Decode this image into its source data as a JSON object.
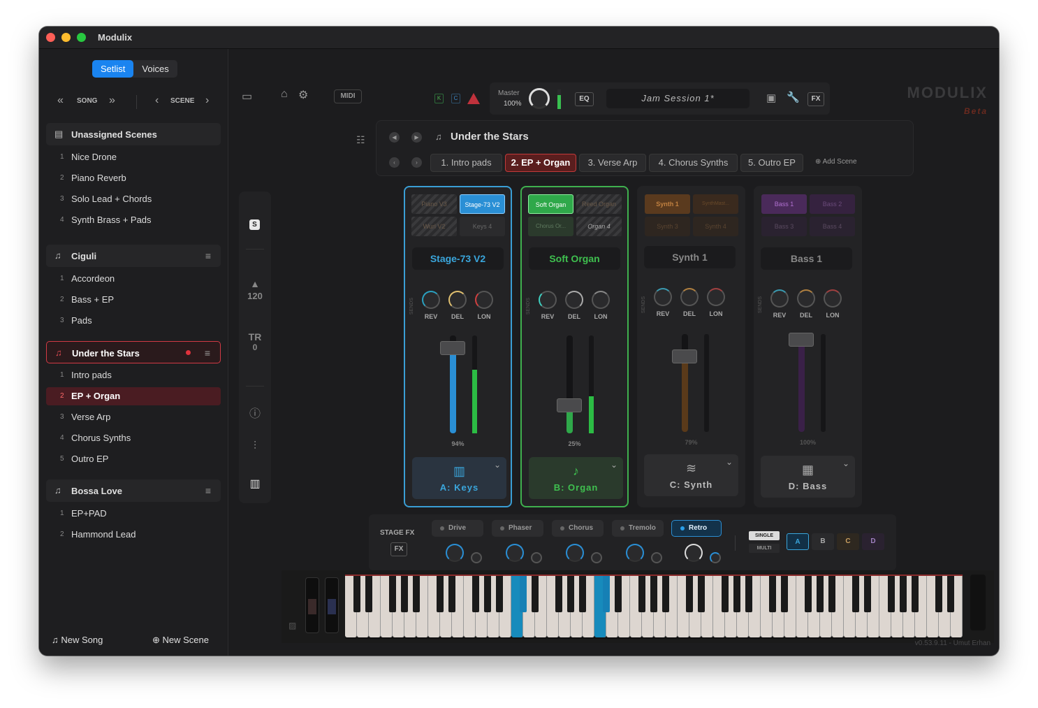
{
  "window": {
    "title": "Modulix"
  },
  "sidebar": {
    "tabs": [
      {
        "label": "Setlist",
        "active": true
      },
      {
        "label": "Voices",
        "active": false
      }
    ],
    "song_nav": {
      "label": "SONG"
    },
    "scene_nav": {
      "label": "SCENE"
    },
    "groups": [
      {
        "title": "Unassigned Scenes",
        "icon": "archive-icon",
        "items": [
          "Nice Drone",
          "Piano Reverb",
          "Solo Lead + Chords",
          "Synth Brass + Pads"
        ]
      },
      {
        "title": "Ciguli",
        "icon": "song-icon",
        "items": [
          "Accordeon",
          "Bass + EP",
          "Pads"
        ]
      },
      {
        "title": "Under the Stars",
        "icon": "song-icon",
        "active": true,
        "items": [
          "Intro pads",
          "EP + Organ",
          "Verse Arp",
          "Chorus Synths",
          "Outro EP"
        ],
        "selected_index": 1
      },
      {
        "title": "Bossa Love",
        "icon": "song-icon",
        "items": [
          "EP+PAD",
          "Hammond Lead"
        ]
      }
    ],
    "bottom": {
      "new_song": "New Song",
      "new_scene": "New Scene"
    }
  },
  "toolbar": {
    "midi": "MIDI",
    "indicators": [
      "K",
      "C"
    ],
    "master_label": "Master",
    "master_value": "100%",
    "eq": "EQ",
    "session": "Jam Session 1*",
    "fx": "FX"
  },
  "brand": {
    "logo": "MODULIX",
    "tag": "Beta"
  },
  "song": {
    "title": "Under the Stars",
    "scenes": [
      "1. Intro pads",
      "2. EP + Organ",
      "3. Verse Arp",
      "4. Chorus Synths",
      "5. Outro EP"
    ],
    "active_scene": 1,
    "add_scene": "Add Scene"
  },
  "side_rail": {
    "s_label": "S",
    "tempo": "120",
    "tr_label": "TR",
    "tr_value": "0"
  },
  "channels": [
    {
      "slots": [
        "Piano V3",
        "Stage-73 V2",
        "Wurl V2",
        "Keys 4"
      ],
      "active_name": "Stage-73 V2",
      "sends": "SENDS",
      "knob_labels": [
        "REV",
        "DEL",
        "LON"
      ],
      "level_percent": 94,
      "level_text": "94%",
      "label": "A: Keys",
      "color": "#3aa6dc",
      "icon": "piano-icon"
    },
    {
      "slots": [
        "Soft Organ",
        "Reed Organ",
        "Chorus Or...",
        "Organ 4"
      ],
      "active_name": "Soft Organ",
      "sends": "SENDS",
      "knob_labels": [
        "REV",
        "DEL",
        "LON"
      ],
      "level_percent": 25,
      "level_text": "25%",
      "label": "B: Organ",
      "color": "#3fc04f",
      "icon": "music-note-icon"
    },
    {
      "slots": [
        "Synth 1",
        "SynthMast...",
        "Synth 3",
        "Synth 4"
      ],
      "active_name": "Synth 1",
      "sends": "SENDS",
      "knob_labels": [
        "REV",
        "DEL",
        "LON"
      ],
      "level_percent": 79,
      "level_text": "79%",
      "label": "C: Synth",
      "color": "#c07a2c",
      "icon": "waveform-icon"
    },
    {
      "slots": [
        "Bass 1",
        "Bass 2",
        "Bass 3",
        "Bass 4"
      ],
      "active_name": "Bass 1",
      "sends": "SENDS",
      "knob_labels": [
        "REV",
        "DEL",
        "LON"
      ],
      "level_percent": 100,
      "level_text": "100%",
      "label": "D: Bass",
      "color": "#9a52c8",
      "icon": "grid-icon"
    }
  ],
  "stage_fx": {
    "label": "STAGE FX",
    "fx": "FX",
    "effects": [
      {
        "name": "Drive",
        "on": false
      },
      {
        "name": "Phaser",
        "on": false
      },
      {
        "name": "Chorus",
        "on": false
      },
      {
        "name": "Tremolo",
        "on": false
      },
      {
        "name": "Retro",
        "on": true
      }
    ],
    "modes": [
      "SINGLE",
      "MULTI"
    ],
    "parts": [
      "A",
      "B",
      "C",
      "D"
    ],
    "active_part": "A"
  },
  "keyboard": {
    "highlighted_white": [
      14,
      21
    ]
  },
  "footer": {
    "version": "v0.53.9.11 - Umut Erhan"
  }
}
